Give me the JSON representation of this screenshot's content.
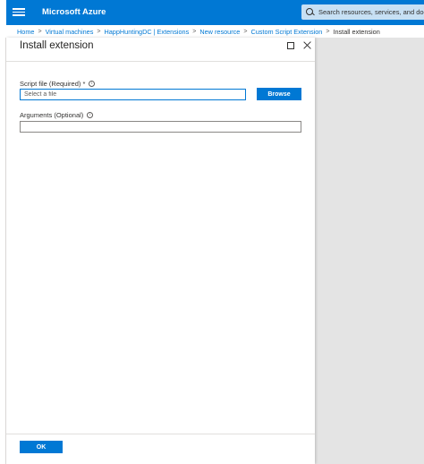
{
  "header": {
    "brand": "Microsoft Azure",
    "search_placeholder": "Search resources, services, and doc",
    "icons": {
      "menu": "hamburger-menu-icon",
      "search": "search-icon"
    }
  },
  "breadcrumb": {
    "items": [
      {
        "label": "Home"
      },
      {
        "label": "Virtual machines"
      },
      {
        "label": "HappHuntingDC | Extensions"
      },
      {
        "label": "New resource"
      },
      {
        "label": "Custom Script Extension"
      }
    ],
    "current": "Install extension"
  },
  "panel": {
    "title": "Install extension",
    "script_label": "Script file (Required)",
    "required_marker": "*",
    "file_placeholder": "Select a file",
    "browse_label": "Browse",
    "args_label": "Arguments (Optional)",
    "args_value": "",
    "ok_label": "OK"
  },
  "colors": {
    "accent": "#0078d4",
    "backdrop": "#e4e4e4",
    "search_bg": "#c7e0f4"
  }
}
